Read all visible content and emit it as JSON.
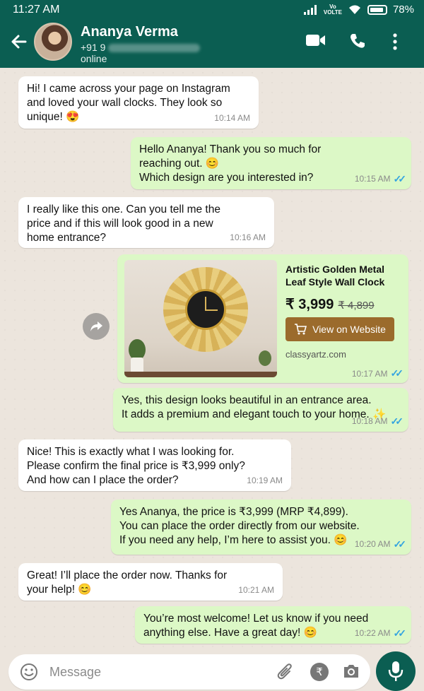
{
  "status_bar": {
    "time": "11:27 AM",
    "network": "Vo VoLTE",
    "battery": "78%"
  },
  "header": {
    "contact_name": "Ananya Verma",
    "phone_prefix": "+91 9",
    "status": "online"
  },
  "messages": [
    {
      "direction": "in",
      "text": "Hi! I came across your page on Instagram\nand loved your wall clocks. They look so\nunique! 😍",
      "time": "10:14 AM"
    },
    {
      "direction": "out",
      "text": "Hello Ananya! Thank you so much for\nreaching out. 😊\nWhich design are you interested in?",
      "time": "10:15 AM"
    },
    {
      "direction": "in",
      "text": "I really like this one. Can you tell me the\nprice and if this will look good in a new\nhome entrance?",
      "time": "10:16 AM"
    },
    {
      "direction": "out",
      "text": "Yes, this design looks beautiful in an entrance area.\nIt adds a premium and elegant touch to your home. ✨",
      "time": "10:18 AM"
    },
    {
      "direction": "in",
      "text": "Nice! This is exactly what I was looking for.\nPlease confirm the final price is ₹3,999 only?\nAnd how can I place the order?",
      "time": "10:19 AM"
    },
    {
      "direction": "out",
      "text": "Yes Ananya, the price is ₹3,999 (MRP ₹4,899).\nYou can place the order directly from our website.\nIf you need any help, I’m here to assist you. 😊",
      "time": "10:20 AM"
    },
    {
      "direction": "in",
      "text": "Great! I’ll place the order now. Thanks for\nyour help! 😊",
      "time": "10:21 AM"
    },
    {
      "direction": "out",
      "text": "You’re most welcome! Let us know if you need\nanything else. Have a great day! 😊",
      "time": "10:22 AM"
    }
  ],
  "product_card": {
    "title": "Artistic Golden Metal Leaf Style Wall Clock",
    "price": "₹ 3,999",
    "mrp": "₹ 4,899",
    "button_label": "View on Website",
    "domain": "classyartz.com",
    "time": "10:17 AM"
  },
  "input": {
    "placeholder": "Message"
  },
  "colors": {
    "header": "#0b5e52",
    "outgoing_bubble": "#dcf8c6",
    "incoming_bubble": "#ffffff",
    "read_ticks": "#34a4e0",
    "product_button": "#9b6b2c"
  },
  "icons": [
    "back-arrow-icon",
    "video-call-icon",
    "phone-call-icon",
    "more-vert-icon",
    "forward-icon",
    "cart-icon",
    "emoji-icon",
    "attach-icon",
    "rupee-icon",
    "camera-icon",
    "mic-icon",
    "double-tick-icon"
  ]
}
